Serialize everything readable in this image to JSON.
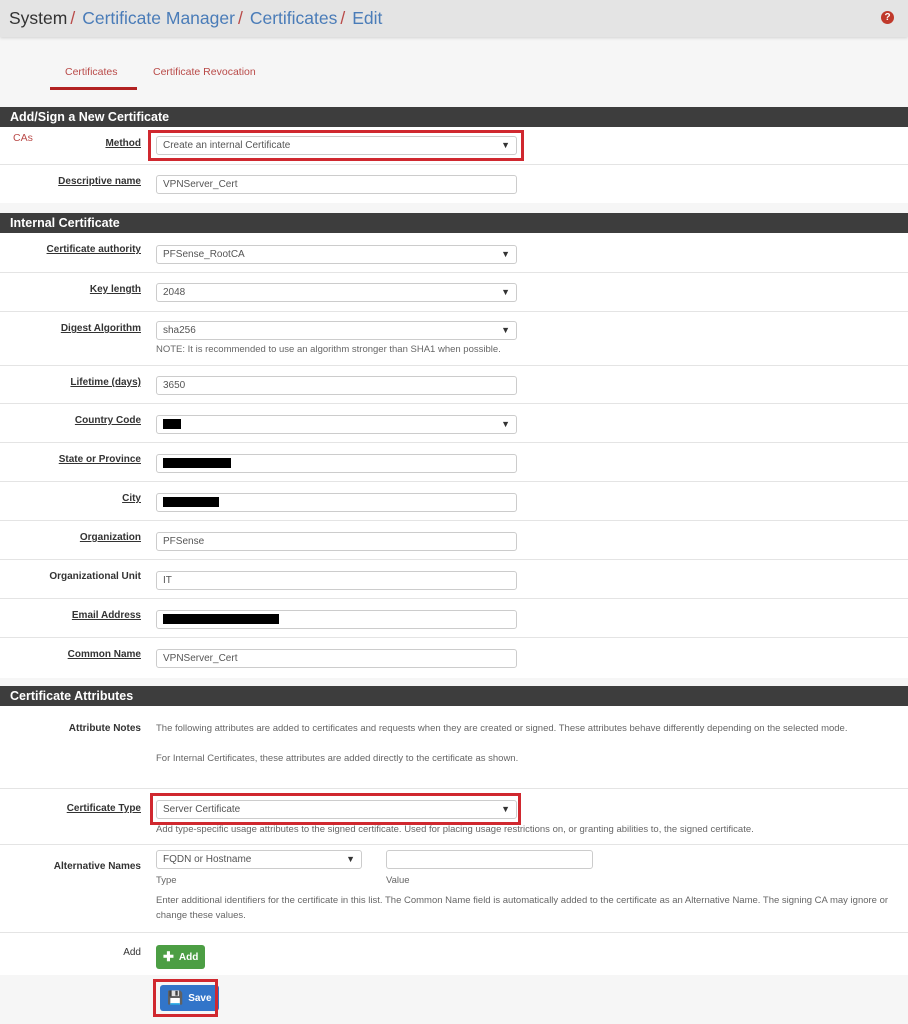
{
  "breadcrumb": [
    "System",
    "Certificate Manager",
    "Certificates",
    "Edit"
  ],
  "help_icon": "question-circle-icon",
  "tabs": [
    {
      "label": "CAs",
      "active": false
    },
    {
      "label": "Certificates",
      "active": true
    },
    {
      "label": "Certificate Revocation",
      "active": false
    }
  ],
  "add_section": {
    "title": "Add/Sign a New Certificate",
    "method": {
      "label": "Method",
      "value": "Create an internal Certificate"
    },
    "descr": {
      "label": "Descriptive name",
      "value": "VPNServer_Cert"
    }
  },
  "internal_section": {
    "title": "Internal Certificate",
    "ca": {
      "label": "Certificate authority",
      "value": "PFSense_RootCA"
    },
    "keylen": {
      "label": "Key length",
      "value": "2048"
    },
    "digest": {
      "label": "Digest Algorithm",
      "value": "sha256",
      "note": "NOTE: It is recommended to use an algorithm stronger than SHA1 when possible."
    },
    "lifetime": {
      "label": "Lifetime (days)",
      "value": "3650"
    },
    "country": {
      "label": "Country Code",
      "value": "[redacted]"
    },
    "state": {
      "label": "State or Province",
      "value": "[redacted]"
    },
    "city": {
      "label": "City",
      "value": "[redacted]"
    },
    "org": {
      "label": "Organization",
      "value": "PFSense"
    },
    "orgunit": {
      "label": "Organizational Unit",
      "value": "IT"
    },
    "email": {
      "label": "Email Address",
      "value": "[redacted]"
    },
    "cn": {
      "label": "Common Name",
      "value": "VPNServer_Cert"
    }
  },
  "attributes_section": {
    "title": "Certificate Attributes",
    "notes": {
      "label": "Attribute Notes",
      "text1": "The following attributes are added to certificates and requests when they are created or signed. These attributes behave differently depending on the selected mode.",
      "text2": "For Internal Certificates, these attributes are added directly to the certificate as shown."
    },
    "cert_type": {
      "label": "Certificate Type",
      "value": "Server Certificate",
      "note": "Add type-specific usage attributes to the signed certificate. Used for placing usage restrictions on, or granting abilities to, the signed certificate."
    },
    "altnames": {
      "label": "Alternative Names",
      "type_value": "FQDN or Hostname",
      "type_caption": "Type",
      "value_value": "",
      "value_caption": "Value",
      "note": "Enter additional identifiers for the certificate in this list. The Common Name field is automatically added to the certificate as an Alternative Name. The signing CA may ignore or change these values."
    },
    "add": {
      "label": "Add",
      "button": "Add"
    }
  },
  "save_button": "Save",
  "colors": {
    "accent_red": "#d0282f",
    "link_blue": "#4a7cb8",
    "add_green": "#4c9e44",
    "save_blue": "#3275c9",
    "panel_head": "#3d3d3d"
  }
}
